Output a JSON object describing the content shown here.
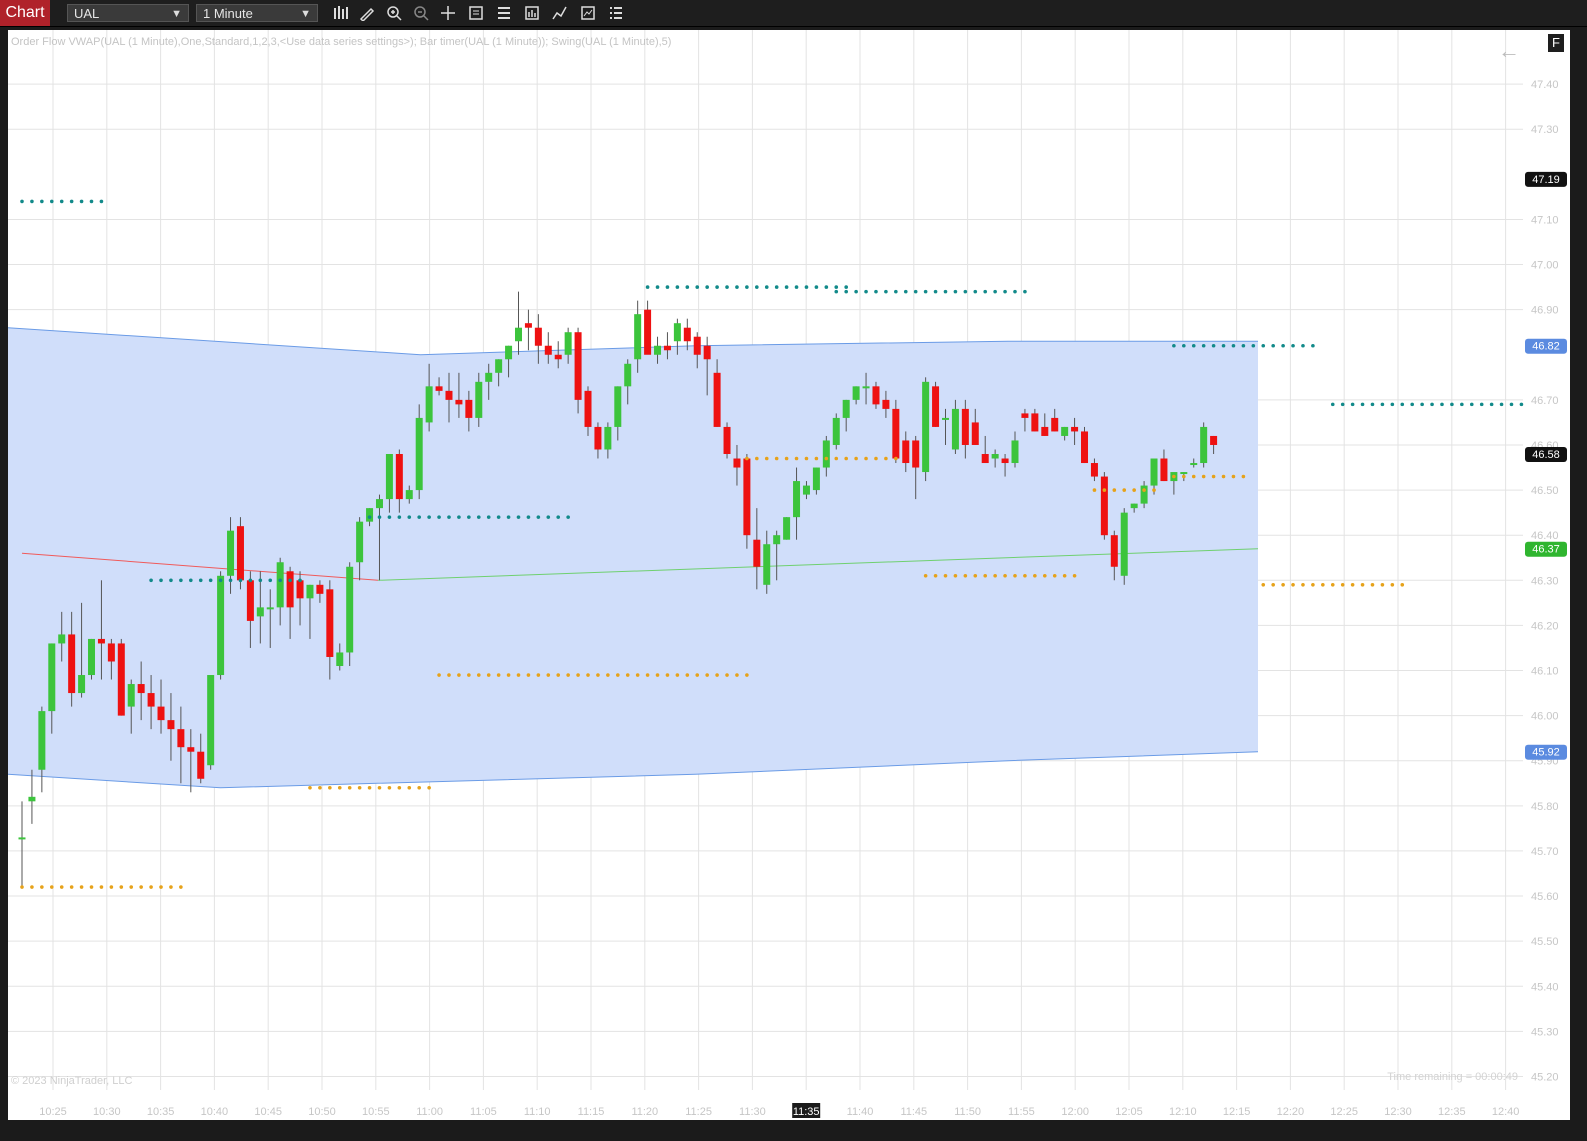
{
  "toolbar": {
    "chart_tab": "Chart",
    "instrument": "UAL",
    "interval": "1 Minute",
    "icons": [
      "bar-type-icon",
      "drawing-tool-icon",
      "zoom-in-icon",
      "zoom-out-icon",
      "crosshair-icon",
      "data-box-icon",
      "properties-icon",
      "templates-icon",
      "strategies-icon",
      "indicators-icon",
      "chart-trader-icon"
    ]
  },
  "chart": {
    "indicator_label": "Order Flow VWAP(UAL (1 Minute),One,Standard,1,2,3,<Use data series settings>); Bar timer(UAL (1 Minute)); Swing(UAL (1 Minute),5)",
    "copyright": "© 2023 NinjaTrader, LLC",
    "time_remaining": "Time remaining = 00:00:49",
    "f_button": "F",
    "back_arrow": "←"
  },
  "chart_data": {
    "type": "candlestick",
    "x_labels": [
      "10:25",
      "10:30",
      "10:35",
      "10:40",
      "10:45",
      "10:50",
      "10:55",
      "11:00",
      "11:05",
      "11:10",
      "11:15",
      "11:20",
      "11:25",
      "11:30",
      "11:35",
      "11:40",
      "11:45",
      "11:50",
      "11:55",
      "12:00",
      "12:05",
      "12:10",
      "12:15",
      "12:20",
      "12:25",
      "12:30",
      "12:35",
      "12:40"
    ],
    "x_highlight": "11:35",
    "y_labels": [
      "47.40",
      "47.30",
      "47.10",
      "47.00",
      "46.90",
      "46.70",
      "46.60",
      "46.50",
      "46.40",
      "46.30",
      "46.20",
      "46.10",
      "46.00",
      "45.90",
      "45.80",
      "45.70",
      "45.60",
      "45.50",
      "45.40",
      "45.30",
      "45.20"
    ],
    "ylim": [
      45.17,
      47.52
    ],
    "price_flags": [
      {
        "value": "47.19",
        "bg": "#111111",
        "fg": "#ffffff"
      },
      {
        "value": "46.82",
        "bg": "#5b8be0",
        "fg": "#ffffff"
      },
      {
        "value": "46.58",
        "bg": "#111111",
        "fg": "#ffffff"
      },
      {
        "value": "46.37",
        "bg": "#2fb52f",
        "fg": "#ffffff"
      },
      {
        "value": "45.92",
        "bg": "#5b8be0",
        "fg": "#ffffff"
      }
    ],
    "colors": {
      "up": "#3cc43c",
      "down": "#ee1111",
      "band_fill": "#d0defa",
      "band_line": "#6a9be6",
      "vwap_below": "#f05a5a",
      "vwap_above": "#6fd06f",
      "swing_high": "#128a8a",
      "swing_low": "#e6a21a",
      "grid": "#e3e3e3"
    },
    "candles": [
      [
        45.73,
        45.81,
        45.62,
        45.73
      ],
      [
        45.81,
        45.88,
        45.76,
        45.82
      ],
      [
        45.88,
        46.02,
        45.83,
        46.01
      ],
      [
        46.01,
        46.16,
        45.96,
        46.16
      ],
      [
        46.16,
        46.23,
        46.12,
        46.18
      ],
      [
        46.18,
        46.23,
        46.02,
        46.05
      ],
      [
        46.05,
        46.25,
        46.04,
        46.09
      ],
      [
        46.09,
        46.17,
        46.08,
        46.17
      ],
      [
        46.17,
        46.3,
        46.08,
        46.16
      ],
      [
        46.16,
        46.17,
        46.08,
        46.12
      ],
      [
        46.16,
        46.17,
        46.0,
        46.0
      ],
      [
        46.02,
        46.08,
        45.96,
        46.07
      ],
      [
        46.07,
        46.12,
        45.99,
        46.05
      ],
      [
        46.05,
        46.09,
        45.97,
        46.02
      ],
      [
        46.02,
        46.08,
        45.96,
        45.99
      ],
      [
        45.99,
        46.05,
        45.9,
        45.97
      ],
      [
        45.97,
        46.02,
        45.85,
        45.93
      ],
      [
        45.93,
        45.97,
        45.83,
        45.92
      ],
      [
        45.92,
        45.96,
        45.85,
        45.86
      ],
      [
        45.89,
        46.08,
        45.88,
        46.09
      ],
      [
        46.09,
        46.32,
        46.08,
        46.31
      ],
      [
        46.31,
        46.44,
        46.27,
        46.41
      ],
      [
        46.42,
        46.44,
        46.28,
        46.3
      ],
      [
        46.3,
        46.32,
        46.15,
        46.21
      ],
      [
        46.22,
        46.32,
        46.16,
        46.24
      ],
      [
        46.24,
        46.28,
        46.15,
        46.24
      ],
      [
        46.24,
        46.35,
        46.2,
        46.34
      ],
      [
        46.32,
        46.33,
        46.17,
        46.24
      ],
      [
        46.3,
        46.32,
        46.2,
        46.26
      ],
      [
        46.26,
        46.29,
        46.17,
        46.29
      ],
      [
        46.29,
        46.3,
        46.25,
        46.27
      ],
      [
        46.28,
        46.3,
        46.08,
        46.13
      ],
      [
        46.11,
        46.16,
        46.1,
        46.14
      ],
      [
        46.14,
        46.34,
        46.11,
        46.33
      ],
      [
        46.34,
        46.44,
        46.3,
        46.43
      ],
      [
        46.43,
        46.46,
        46.42,
        46.46
      ],
      [
        46.46,
        46.49,
        46.3,
        46.48
      ],
      [
        46.48,
        46.58,
        46.45,
        46.58
      ],
      [
        46.58,
        46.59,
        46.45,
        46.48
      ],
      [
        46.48,
        46.51,
        46.47,
        46.5
      ],
      [
        46.5,
        46.69,
        46.48,
        46.66
      ],
      [
        46.65,
        46.78,
        46.63,
        46.73
      ],
      [
        46.73,
        46.75,
        46.71,
        46.72
      ],
      [
        46.72,
        46.76,
        46.65,
        46.7
      ],
      [
        46.7,
        46.76,
        46.66,
        46.69
      ],
      [
        46.7,
        46.72,
        46.63,
        46.66
      ],
      [
        46.66,
        46.76,
        46.64,
        46.74
      ],
      [
        46.74,
        46.78,
        46.7,
        46.76
      ],
      [
        46.76,
        46.79,
        46.73,
        46.79
      ],
      [
        46.79,
        46.82,
        46.75,
        46.82
      ],
      [
        46.83,
        46.94,
        46.8,
        46.86
      ],
      [
        46.87,
        46.9,
        46.81,
        46.86
      ],
      [
        46.86,
        46.89,
        46.78,
        46.82
      ],
      [
        46.82,
        46.85,
        46.78,
        46.8
      ],
      [
        46.8,
        46.83,
        46.77,
        46.79
      ],
      [
        46.8,
        46.86,
        46.78,
        46.85
      ],
      [
        46.85,
        46.86,
        46.67,
        46.7
      ],
      [
        46.72,
        46.73,
        46.62,
        46.64
      ],
      [
        46.64,
        46.65,
        46.57,
        46.59
      ],
      [
        46.59,
        46.65,
        46.57,
        46.64
      ],
      [
        46.64,
        46.73,
        46.61,
        46.73
      ],
      [
        46.73,
        46.79,
        46.69,
        46.78
      ],
      [
        46.79,
        46.92,
        46.76,
        46.89
      ],
      [
        46.9,
        46.92,
        46.81,
        46.8
      ],
      [
        46.8,
        46.84,
        46.78,
        46.82
      ],
      [
        46.82,
        46.85,
        46.79,
        46.81
      ],
      [
        46.83,
        46.88,
        46.8,
        46.87
      ],
      [
        46.86,
        46.88,
        46.81,
        46.83
      ],
      [
        46.84,
        46.85,
        46.77,
        46.8
      ],
      [
        46.82,
        46.84,
        46.71,
        46.79
      ],
      [
        46.76,
        46.79,
        46.64,
        46.64
      ],
      [
        46.64,
        46.65,
        46.57,
        46.58
      ],
      [
        46.57,
        46.6,
        46.51,
        46.55
      ],
      [
        46.57,
        46.58,
        46.37,
        46.4
      ],
      [
        46.39,
        46.46,
        46.28,
        46.33
      ],
      [
        46.29,
        46.41,
        46.27,
        46.38
      ],
      [
        46.38,
        46.41,
        46.3,
        46.4
      ],
      [
        46.39,
        46.44,
        46.39,
        46.44
      ],
      [
        46.44,
        46.55,
        46.39,
        46.52
      ],
      [
        46.49,
        46.52,
        46.48,
        46.51
      ],
      [
        46.5,
        46.55,
        46.49,
        46.55
      ],
      [
        46.55,
        46.62,
        46.53,
        46.61
      ],
      [
        46.6,
        46.67,
        46.59,
        46.66
      ],
      [
        46.66,
        46.7,
        46.63,
        46.7
      ],
      [
        46.7,
        46.73,
        46.69,
        46.73
      ],
      [
        46.73,
        46.76,
        46.69,
        46.73
      ],
      [
        46.73,
        46.74,
        46.68,
        46.69
      ],
      [
        46.7,
        46.72,
        46.66,
        46.68
      ],
      [
        46.68,
        46.7,
        46.56,
        46.57
      ],
      [
        46.61,
        46.63,
        46.54,
        46.56
      ],
      [
        46.61,
        46.62,
        46.48,
        46.55
      ],
      [
        46.54,
        46.75,
        46.52,
        46.74
      ],
      [
        46.73,
        46.74,
        46.64,
        46.64
      ],
      [
        46.66,
        46.68,
        46.6,
        46.66
      ],
      [
        46.59,
        46.7,
        46.58,
        46.68
      ],
      [
        46.68,
        46.7,
        46.57,
        46.6
      ],
      [
        46.65,
        46.68,
        46.6,
        46.6
      ],
      [
        46.58,
        46.62,
        46.56,
        46.56
      ],
      [
        46.57,
        46.59,
        46.55,
        46.58
      ],
      [
        46.57,
        46.58,
        46.53,
        46.56
      ],
      [
        46.56,
        46.63,
        46.55,
        46.61
      ],
      [
        46.67,
        46.68,
        46.63,
        46.66
      ],
      [
        46.67,
        46.68,
        46.63,
        46.63
      ],
      [
        46.64,
        46.67,
        46.62,
        46.62
      ],
      [
        46.66,
        46.68,
        46.63,
        46.63
      ],
      [
        46.62,
        46.64,
        46.61,
        46.64
      ],
      [
        46.64,
        46.66,
        46.6,
        46.63
      ],
      [
        46.63,
        46.64,
        46.56,
        46.56
      ],
      [
        46.56,
        46.57,
        46.52,
        46.53
      ],
      [
        46.53,
        46.54,
        46.39,
        46.4
      ],
      [
        46.4,
        46.41,
        46.3,
        46.33
      ],
      [
        46.31,
        46.46,
        46.29,
        46.45
      ],
      [
        46.46,
        46.47,
        46.45,
        46.47
      ],
      [
        46.47,
        46.52,
        46.46,
        46.51
      ],
      [
        46.51,
        46.56,
        46.49,
        46.57
      ],
      [
        46.57,
        46.59,
        46.52,
        46.52
      ],
      [
        46.52,
        46.53,
        46.49,
        46.54
      ],
      [
        46.54,
        46.54,
        46.52,
        46.54
      ],
      [
        46.56,
        46.57,
        46.55,
        46.56
      ],
      [
        46.56,
        46.65,
        46.55,
        46.64
      ],
      [
        46.62,
        46.62,
        46.58,
        46.6
      ]
    ],
    "vwap": {
      "start": 46.36,
      "mid": 46.3,
      "end": 46.37
    },
    "upper_band": [
      [
        0,
        46.86
      ],
      [
        0.33,
        46.8
      ],
      [
        0.55,
        46.82
      ],
      [
        0.8,
        46.83
      ],
      [
        1.0,
        46.83
      ]
    ],
    "lower_band": [
      [
        0,
        45.87
      ],
      [
        0.17,
        45.84
      ],
      [
        0.55,
        45.87
      ],
      [
        0.8,
        45.9
      ],
      [
        1.0,
        45.92
      ]
    ],
    "swing_highs": [
      [
        0,
        8,
        47.14
      ],
      [
        13,
        28,
        46.3
      ],
      [
        35,
        55,
        46.44
      ],
      [
        63,
        83,
        46.95
      ],
      [
        82,
        101,
        46.94
      ],
      [
        116,
        130,
        46.82
      ],
      [
        132,
        151,
        46.69
      ]
    ],
    "swing_lows": [
      [
        0,
        16,
        45.62
      ],
      [
        29,
        41,
        45.84
      ],
      [
        42,
        73,
        46.09
      ],
      [
        73,
        88,
        46.57
      ],
      [
        91,
        106,
        46.31
      ],
      [
        108,
        114,
        46.5
      ],
      [
        116,
        123,
        46.53
      ],
      [
        125,
        139,
        46.29
      ]
    ]
  }
}
